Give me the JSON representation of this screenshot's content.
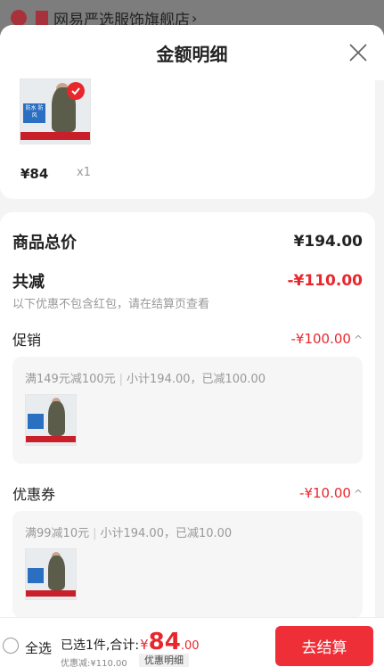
{
  "store": {
    "name": "网易严选服饰旗舰店",
    "arrow": "›"
  },
  "sheet": {
    "title": "金额明细"
  },
  "item": {
    "price": "¥84",
    "qty": "x1",
    "badge_text": "防水\n防风"
  },
  "summary": {
    "total_label": "商品总价",
    "total_value": "¥194.00",
    "reduce_label": "共减",
    "reduce_value": "-¥110.00",
    "hint": "以下优惠不包含红包，请在结算页查看"
  },
  "promo": {
    "label": "促销",
    "value": "-¥100.00",
    "caret": "^",
    "rule": "满149元减100元",
    "detail": "小计194.00，已减100.00"
  },
  "coupon": {
    "label": "优惠券",
    "value": "-¥10.00",
    "caret": "^",
    "rule": "满99减10元",
    "detail": "小计194.00，已减10.00"
  },
  "bottom": {
    "select_all": "全选",
    "selected_text": "已选1件,合计:",
    "yen": "¥",
    "amount_int": "84",
    "amount_dec": ".00",
    "discount_text": "优惠减:¥110.00",
    "detail_chip": "优惠明细",
    "checkout_label": "去结算"
  },
  "colors": {
    "accent": "#ef2f38",
    "overlay": "#7d7d7d"
  }
}
